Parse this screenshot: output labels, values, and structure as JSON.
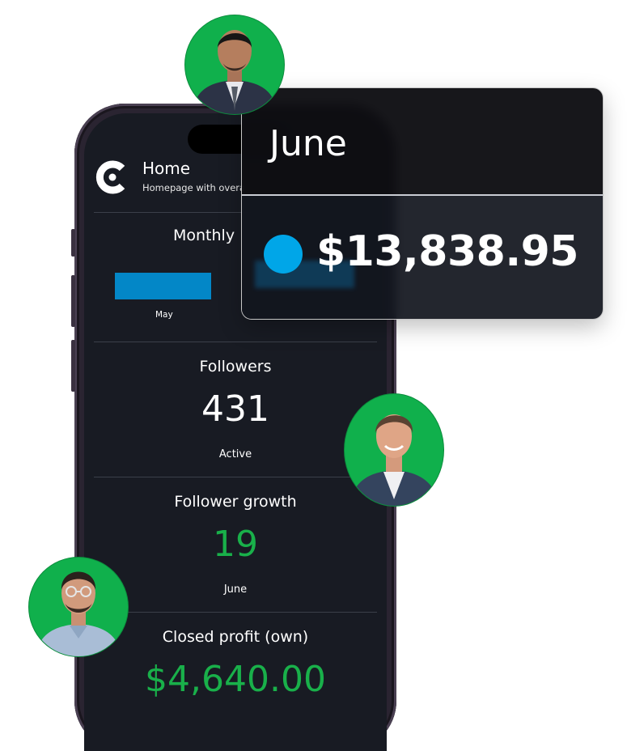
{
  "app": {
    "title": "Home",
    "subtitle": "Homepage with overa"
  },
  "monthly": {
    "title": "Monthly",
    "bars": [
      {
        "label": "May",
        "value": 1
      }
    ]
  },
  "followers": {
    "title": "Followers",
    "value": "431",
    "label": "Active"
  },
  "follower_growth": {
    "title": "Follower growth",
    "value": "19",
    "label": "June"
  },
  "closed_profit": {
    "title": "Closed profit (own)",
    "value": "$4,640.00"
  },
  "tooltip": {
    "month": "June",
    "value": "$13,838.95",
    "dot_color": "#00a6e8"
  },
  "colors": {
    "accent_green": "#19b04a",
    "bar_blue": "#0387c7",
    "screen_bg": "#181b23"
  },
  "avatars": [
    {
      "icon": "man-suit-avatar"
    },
    {
      "icon": "man-blazer-avatar"
    },
    {
      "icon": "man-glasses-avatar"
    }
  ]
}
